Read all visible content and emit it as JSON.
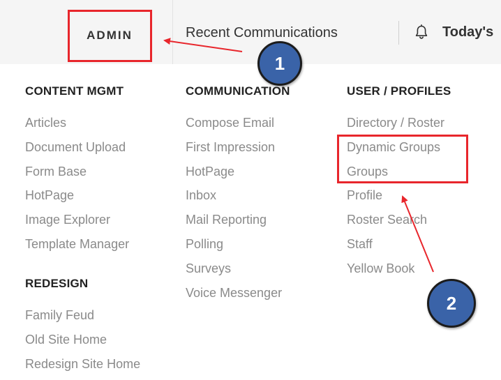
{
  "nav": {
    "admin": "ADMIN",
    "recent_communications": "Recent Communications",
    "todays_label": "Today's"
  },
  "menu": {
    "content_mgmt": {
      "heading": "CONTENT MGMT",
      "items": [
        "Articles",
        "Document Upload",
        "Form Base",
        "HotPage",
        "Image Explorer",
        "Template Manager"
      ]
    },
    "redesign": {
      "heading": "REDESIGN",
      "items": [
        "Family Feud",
        "Old Site Home",
        "Redesign Site Home"
      ]
    },
    "communication": {
      "heading": "COMMUNICATION",
      "items": [
        "Compose Email",
        "First Impression",
        "HotPage",
        "Inbox",
        "Mail Reporting",
        "Polling",
        "Surveys",
        "Voice Messenger"
      ]
    },
    "user_profiles": {
      "heading": "USER / PROFILES",
      "items": [
        "Directory / Roster",
        "Dynamic Groups",
        "Groups",
        "Profile",
        "Roster Search",
        "Staff",
        "Yellow Book"
      ]
    }
  },
  "annotations": {
    "badge_1": "1",
    "badge_2": "2",
    "highlight_color": "#e8262c",
    "badge_color": "#3a63a8"
  },
  "icons": {
    "bell": "bell-icon"
  }
}
